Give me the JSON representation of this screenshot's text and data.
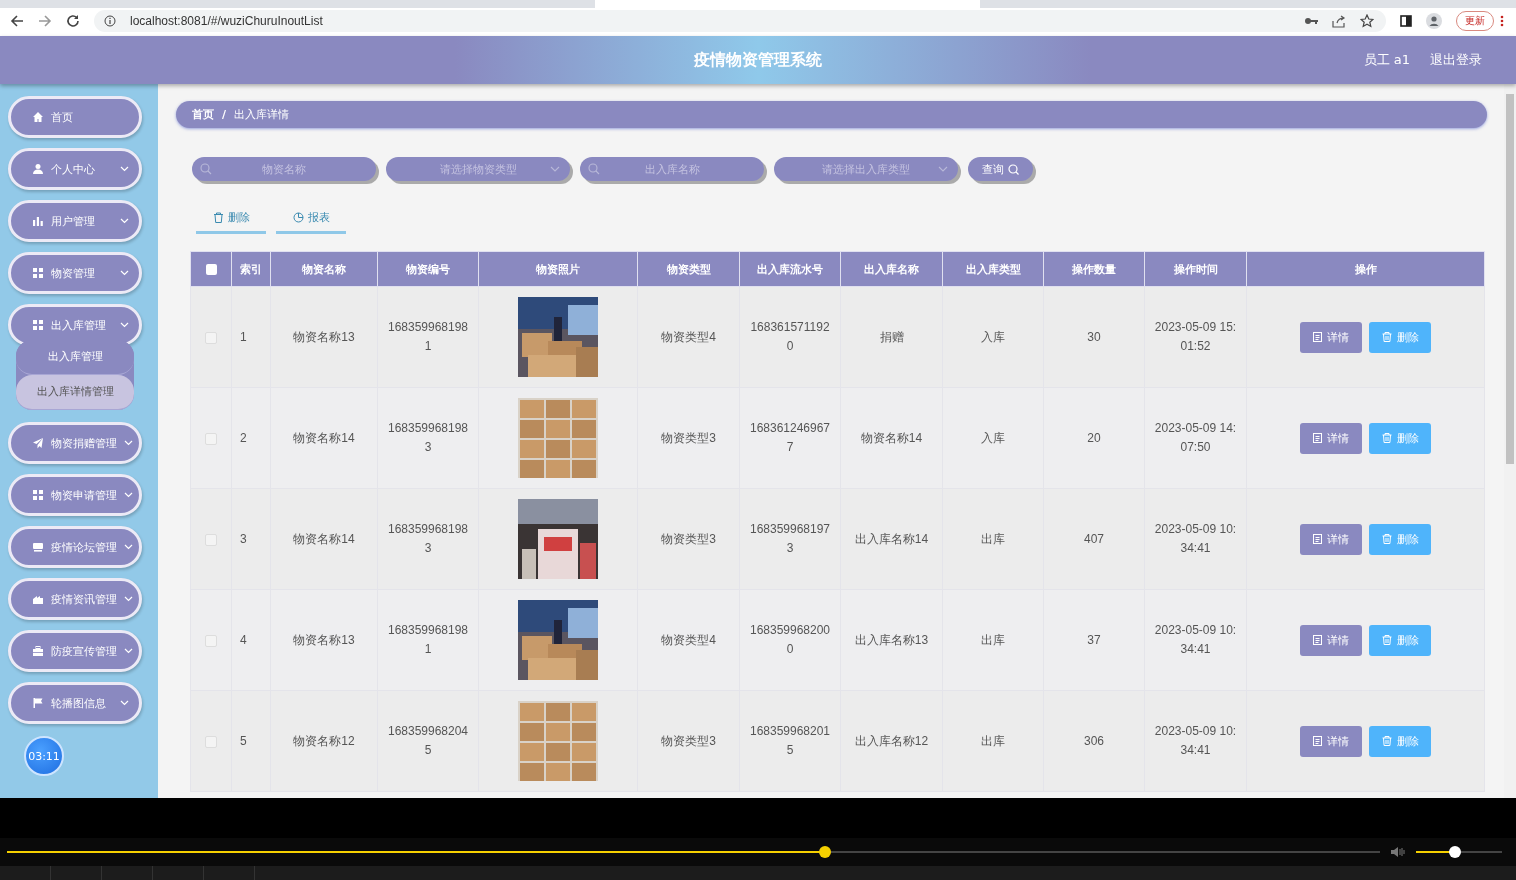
{
  "browser": {
    "url": "localhost:8081/#/wuziChuruInoutList",
    "update_button": "更新"
  },
  "header": {
    "title": "疫情物资管理系统",
    "user": "员工 a1",
    "logout": "退出登录"
  },
  "sidebar": {
    "items": [
      {
        "label": "首页",
        "kind": "home",
        "has_caret": false
      },
      {
        "label": "个人中心",
        "kind": "user",
        "has_caret": true
      },
      {
        "label": "用户管理",
        "kind": "chart",
        "has_caret": true
      },
      {
        "label": "物资管理",
        "kind": "grid",
        "has_caret": true
      },
      {
        "label": "出入库管理",
        "kind": "grid",
        "has_caret": true,
        "expanded": true,
        "children": [
          {
            "label": "出入库管理",
            "selected": false
          },
          {
            "label": "出入库详情管理",
            "selected": true
          }
        ]
      },
      {
        "label": "物资捐赠管理",
        "kind": "send",
        "has_caret": true
      },
      {
        "label": "物资申请管理",
        "kind": "grid",
        "has_caret": true
      },
      {
        "label": "疫情论坛管理",
        "kind": "monitor",
        "has_caret": true
      },
      {
        "label": "疫情资讯管理",
        "kind": "house",
        "has_caret": true
      },
      {
        "label": "防疫宣传管理",
        "kind": "briefcase",
        "has_caret": true
      },
      {
        "label": "轮播图信息",
        "kind": "flag",
        "has_caret": true
      }
    ],
    "timer": "03:11"
  },
  "breadcrumb": {
    "items": [
      "首页",
      "出入库详情"
    ],
    "separator": "/"
  },
  "search": {
    "fields": [
      {
        "kind": "text",
        "placeholder": "物资名称"
      },
      {
        "kind": "select",
        "placeholder": "请选择物资类型"
      },
      {
        "kind": "text",
        "placeholder": "出入库名称"
      },
      {
        "kind": "select",
        "placeholder": "请选择出入库类型"
      }
    ],
    "button": "查询"
  },
  "actions": [
    {
      "kind": "delete",
      "label": "删除"
    },
    {
      "kind": "report",
      "label": "报表"
    }
  ],
  "table": {
    "select_all_checked": false,
    "columns": [
      "索引",
      "物资名称",
      "物资编号",
      "物资照片",
      "物资类型",
      "出入库流水号",
      "出入库名称",
      "出入库类型",
      "操作数量",
      "操作时间",
      "操作"
    ],
    "rows": [
      {
        "checked": false,
        "cells": [
          "1",
          "物资名称13",
          "1683599681981",
          "",
          "物资类型4",
          "1683615711920",
          "捐赠",
          "入库",
          "30",
          "2023-05-09 15:01:52"
        ],
        "actions": [
          "详情",
          "删除"
        ]
      },
      {
        "checked": false,
        "cells": [
          "2",
          "物资名称14",
          "1683599681983",
          "",
          "物资类型3",
          "1683612469677",
          "物资名称14",
          "入库",
          "20",
          "2023-05-09 14:07:50"
        ],
        "actions": [
          "详情",
          "删除"
        ]
      },
      {
        "checked": false,
        "cells": [
          "3",
          "物资名称14",
          "1683599681983",
          "",
          "物资类型3",
          "1683599681973",
          "出入库名称14",
          "出库",
          "407",
          "2023-05-09 10:34:41"
        ],
        "actions": [
          "详情",
          "删除"
        ]
      },
      {
        "checked": false,
        "cells": [
          "4",
          "物资名称13",
          "1683599681981",
          "",
          "物资类型4",
          "1683599682000",
          "出入库名称13",
          "出库",
          "37",
          "2023-05-09 10:34:41"
        ],
        "actions": [
          "详情",
          "删除"
        ]
      },
      {
        "checked": false,
        "cells": [
          "5",
          "物资名称12",
          "1683599682045",
          "",
          "物资类型3",
          "1683599682015",
          "出入库名称12",
          "出库",
          "306",
          "2023-05-09 10:34:41"
        ],
        "actions": [
          "详情",
          "删除"
        ]
      }
    ]
  },
  "player": {
    "progress": {
      "level": 0.596
    },
    "volume": {
      "level": 0.45
    }
  }
}
